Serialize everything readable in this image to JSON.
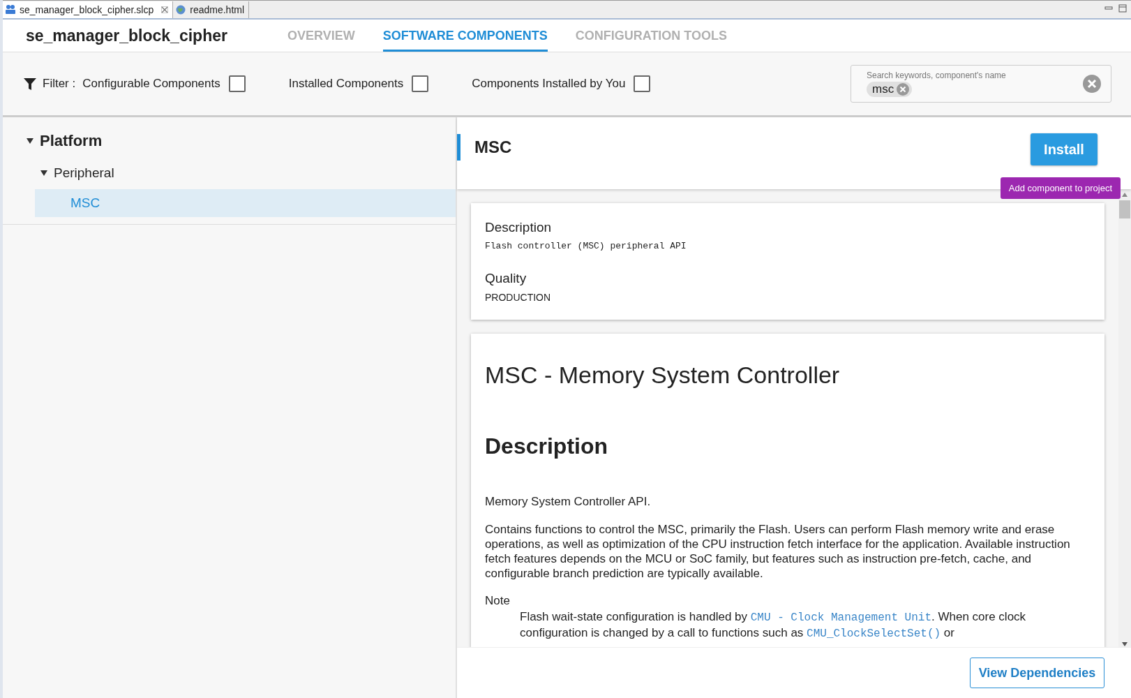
{
  "editor_tabs": [
    {
      "label": "se_manager_block_cipher.slcp",
      "selected": true,
      "kind": "project",
      "closable": true
    },
    {
      "label": "readme.html",
      "selected": false,
      "kind": "web",
      "closable": false
    }
  ],
  "project_title": "se_manager_block_cipher",
  "nav_tabs": [
    {
      "label": "OVERVIEW",
      "selected": false
    },
    {
      "label": "SOFTWARE COMPONENTS",
      "selected": true
    },
    {
      "label": "CONFIGURATION TOOLS",
      "selected": false
    }
  ],
  "filter": {
    "label": "Filter :",
    "options": [
      {
        "label": "Configurable Components",
        "checked": false
      },
      {
        "label": "Installed Components",
        "checked": false
      },
      {
        "label": "Components Installed by You",
        "checked": false
      }
    ]
  },
  "search": {
    "placeholder": "Search keywords, component's name",
    "chips": [
      "msc"
    ]
  },
  "tree": [
    {
      "label": "Platform",
      "expanded": true,
      "selected": false,
      "children": [
        {
          "label": "Peripheral",
          "expanded": true,
          "selected": false,
          "children": [
            {
              "label": "MSC",
              "selected": true
            }
          ]
        }
      ]
    }
  ],
  "component": {
    "name": "MSC",
    "install_button": "Install",
    "tooltip": "Add component to project",
    "info": [
      {
        "heading": "Description",
        "value": "Flash controller (MSC) peripheral API",
        "kind": "mono"
      },
      {
        "heading": "Quality",
        "value": "PRODUCTION",
        "kind": "plain"
      }
    ]
  },
  "doc": {
    "title": "MSC - Memory System Controller",
    "heading": "Description",
    "paragraphs": [
      "Memory System Controller API.",
      "Contains functions to control the MSC, primarily the Flash. Users can perform Flash memory write and erase operations, as well as optimization of the CPU instruction fetch interface for the application. Available instruction fetch features depends on the MCU or SoC family, but features such as instruction pre-fetch, cache, and configurable branch prediction are typically available."
    ],
    "note_label": "Note",
    "note": [
      {
        "kind": "text",
        "text": "Flash wait-state configuration is handled by "
      },
      {
        "kind": "link",
        "text": "CMU - Clock Management Unit"
      },
      {
        "kind": "text",
        "text": ". When core clock configuration is changed by a call to functions such as "
      },
      {
        "kind": "link",
        "text": "CMU_ClockSelectSet()"
      },
      {
        "kind": "text",
        "text": " or"
      }
    ]
  },
  "footer_button": "View Dependencies"
}
